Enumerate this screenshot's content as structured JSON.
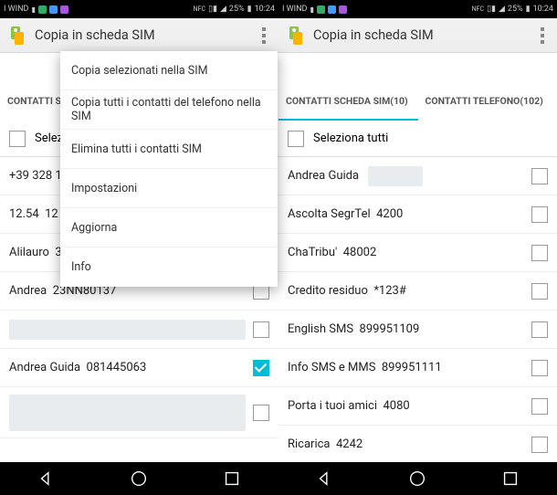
{
  "statusbar": {
    "carrier": "I WIND",
    "battery": "25%",
    "time": "10:24"
  },
  "app": {
    "title": "Copia in scheda SIM"
  },
  "menu": {
    "items": [
      "Copia selezionati nella SIM",
      "Copia tutti i contatti del telefono nella SIM",
      "Elimina tutti i contatti SIM",
      "Impostazioni",
      "Aggiorna",
      "Info"
    ]
  },
  "left": {
    "tab_label_partial": "CONTATTI S",
    "select_all": "Selezi",
    "contacts": [
      {
        "name": "+39 328 1",
        "number": ""
      },
      {
        "name": "12.54",
        "number": "12"
      },
      {
        "name": "Alilauro",
        "number": "3"
      },
      {
        "name": "Andrea",
        "number": "23NN80137"
      },
      {
        "name": "",
        "number": "",
        "redacted": true
      },
      {
        "name": "Andrea Guida",
        "number": "081445063",
        "checked": true
      },
      {
        "name": "",
        "number": "",
        "redacted": true,
        "big": true
      }
    ]
  },
  "right": {
    "tabs": [
      {
        "label": "CONTATTI SCHEDA SIM(10)",
        "active": true
      },
      {
        "label": "CONTATTI TELEFONO(102)",
        "active": false
      }
    ],
    "select_all": "Seleziona tutti",
    "contacts": [
      {
        "name": "Andrea Guida",
        "number": "",
        "redacted_num": true
      },
      {
        "name": "Ascolta SegrTel",
        "number": "4200"
      },
      {
        "name": "ChaTribu'",
        "number": "48002"
      },
      {
        "name": "Credito residuo",
        "number": "*123#"
      },
      {
        "name": "English SMS",
        "number": "899951109"
      },
      {
        "name": "Info SMS e MMS",
        "number": "899951111"
      },
      {
        "name": "Porta i tuoi amici",
        "number": "4080"
      },
      {
        "name": "Ricarica",
        "number": "4242"
      }
    ]
  }
}
